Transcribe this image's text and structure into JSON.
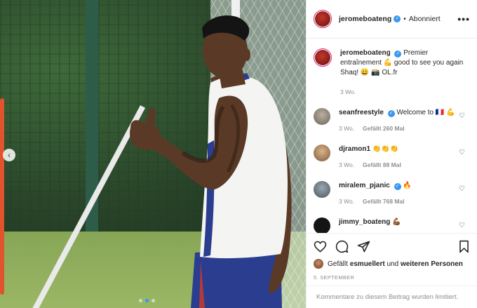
{
  "post": {
    "username": "jeromeboateng",
    "follow_state": "Abonniert",
    "separator": "•",
    "more_icon": "more-horizontal-icon",
    "more_label": "•••",
    "verified_mark": "✓",
    "prev_label": "‹",
    "carousel": {
      "slides": 3,
      "active": 1
    }
  },
  "caption": {
    "username": "jeromeboateng",
    "text": "Premier entraînement 💪 good to see you again Shaq! 😄 📸 OL.fr",
    "time": "3 Wo."
  },
  "comments": [
    {
      "username": "seanfreestyle",
      "verified": true,
      "text": "Welcome to 🇫🇷 💪",
      "time": "3 Wo.",
      "likes": "Gefällt 260 Mal"
    },
    {
      "username": "djramon1",
      "verified": false,
      "text": "👏👏👏",
      "time": "3 Wo.",
      "likes": "Gefällt 88 Mal"
    },
    {
      "username": "miralem_pjanic",
      "verified": true,
      "text": "🔥",
      "time": "3 Wo.",
      "likes": "Gefällt 768 Mal"
    },
    {
      "username": "jimmy_boateng",
      "verified": false,
      "text": "💪🏾",
      "time": "",
      "likes": ""
    }
  ],
  "liked_by": {
    "prefix": "Gefällt",
    "user": "esmuellert",
    "middle": "und",
    "others": "weiteren Personen"
  },
  "date": "5. SEPTEMBER",
  "comments_limited": "Kommentare zu diesem Beitrag wurden limitiert.",
  "colors": {
    "verified": "#3897f0",
    "secondary_text": "#8e8e8e",
    "primary_text": "#262626",
    "divider": "#efefef"
  }
}
